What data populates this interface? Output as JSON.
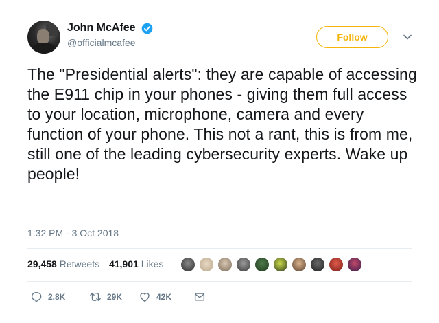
{
  "user": {
    "display_name": "John McAfee",
    "handle": "@officialmcafee",
    "verified": true
  },
  "follow_label": "Follow",
  "tweet": {
    "text": "The \"Presidential alerts\": they are capable of accessing the E911 chip in your phones - giving them full access to your location, microphone, camera and every function of your phone. This not a rant, this is from me, still one of the leading cybersecurity experts. Wake up people!",
    "timestamp": "1:32 PM - 3 Oct 2018"
  },
  "stats": {
    "retweets_count": "29,458",
    "retweets_label": "Retweets",
    "likes_count": "41,901",
    "likes_label": "Likes"
  },
  "actions": {
    "replies": "2.8K",
    "retweets": "29K",
    "likes": "42K"
  },
  "colors": {
    "follow_accent": "#f5b40a",
    "verified_blue": "#1da1f2",
    "muted_text": "#657786"
  },
  "icons": {
    "verified": "verified-badge-icon",
    "chevron": "chevron-down-icon",
    "reply": "reply-icon",
    "retweet": "retweet-icon",
    "like": "heart-icon",
    "dm": "envelope-icon"
  }
}
